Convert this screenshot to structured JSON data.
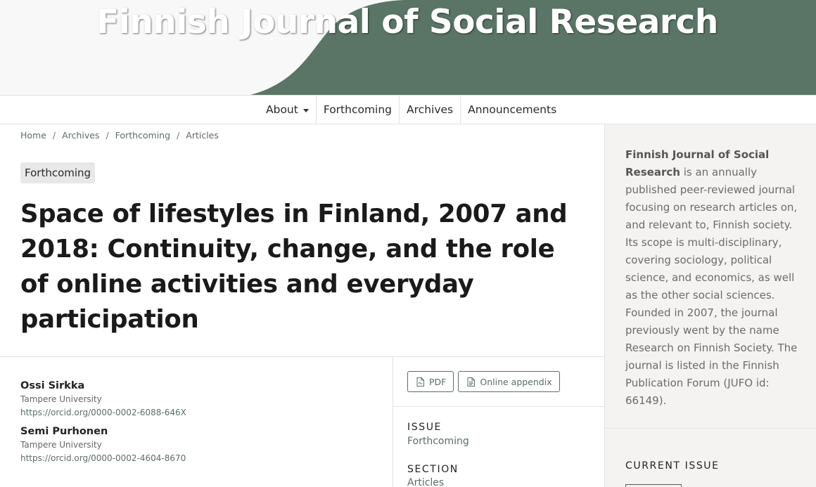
{
  "site": {
    "title": "Finnish Journal of Social Research"
  },
  "colors": {
    "accent": "#5a7566",
    "link": "#5a6e63",
    "header_bg": "#f8f8f8",
    "sidebar_bg": "#f4f3f1"
  },
  "nav": {
    "items": [
      {
        "label": "About",
        "has_dropdown": true
      },
      {
        "label": "Forthcoming"
      },
      {
        "label": "Archives"
      },
      {
        "label": "Announcements"
      }
    ]
  },
  "breadcrumb": [
    "Home",
    "Archives",
    "Forthcoming",
    "Articles"
  ],
  "article": {
    "badge": "Forthcoming",
    "title": "Space of lifestyles in Finland, 2007 and 2018: Continuity, change, and the role of online activities and everyday participation",
    "authors": [
      {
        "name": "Ossi Sirkka",
        "affiliation": "Tampere University",
        "orcid": "https://orcid.org/0000-0002-6088-646X"
      },
      {
        "name": "Semi Purhonen",
        "affiliation": "Tampere University",
        "orcid": "https://orcid.org/0000-0002-4604-8670"
      }
    ],
    "galleys": [
      {
        "label": "PDF",
        "icon": "pdf-file-icon"
      },
      {
        "label": "Online appendix",
        "icon": "document-icon"
      }
    ],
    "issue_label": "ISSUE",
    "issue_value": "Forthcoming",
    "section_label": "SECTION",
    "section_value": "Articles"
  },
  "sidebar": {
    "about_strong": "Finnish Journal of Social Research",
    "about_rest": " is an annually published peer-reviewed journal focusing on research articles on, and relevant to, Finnish society. Its scope is multi-disciplinary, covering sociology, political science, and economics, as well as the other social sciences. Founded in 2007, the journal previously went by the name ",
    "about_link": "Research on Finnish Society",
    "about_end": ". The journal is listed in the Finnish Publication Forum (JUFO id: 66149).",
    "current_issue_heading": "CURRENT ISSUE"
  }
}
